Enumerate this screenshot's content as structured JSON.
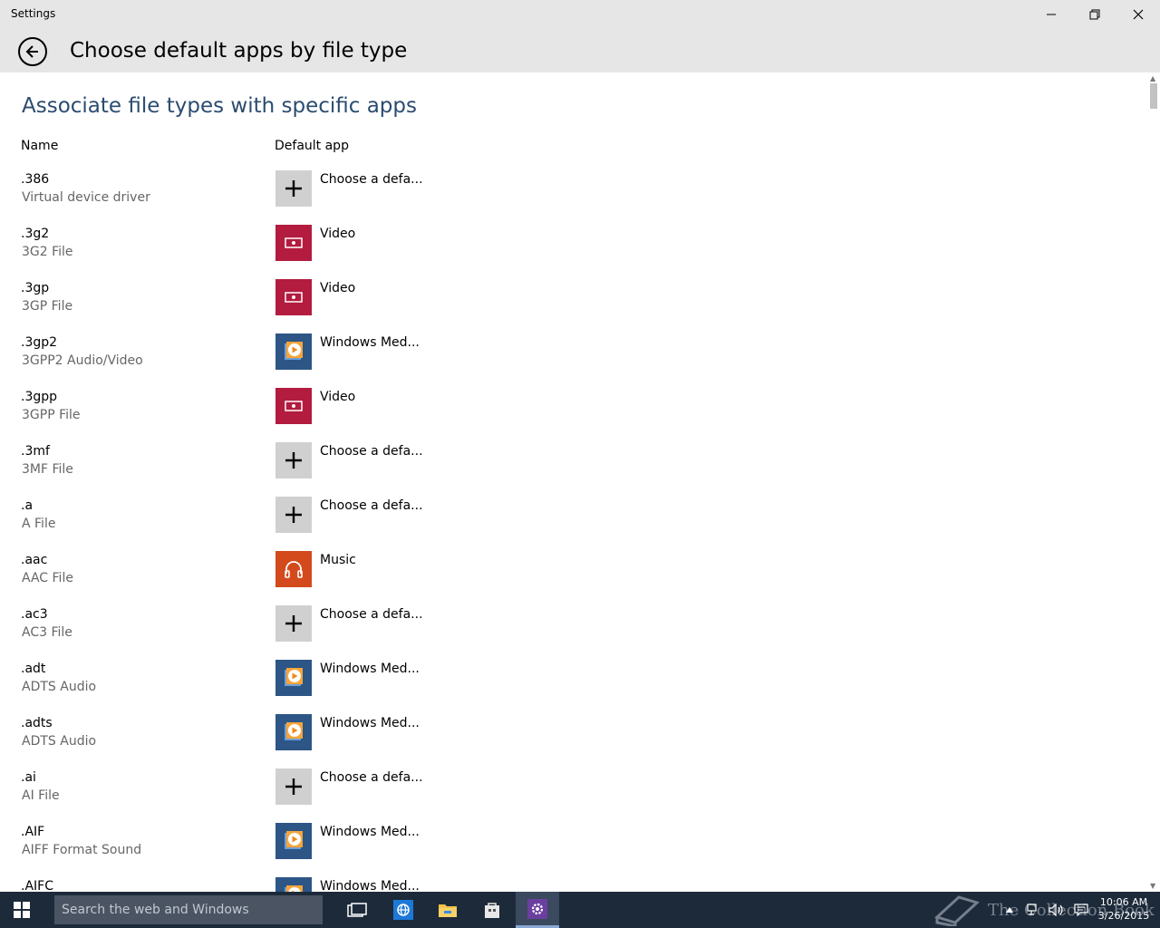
{
  "window": {
    "title": "Settings"
  },
  "header": {
    "page_title": "Choose default apps by file type"
  },
  "content": {
    "section_heading": "Associate file types with specific apps",
    "col_name": "Name",
    "col_app": "Default app",
    "rows": [
      {
        "ext": ".386",
        "desc": "Virtual device driver",
        "app": "Choose a defa...",
        "icon": "plus-icon"
      },
      {
        "ext": ".3g2",
        "desc": "3G2 File",
        "app": "Video",
        "icon": "video-app-icon"
      },
      {
        "ext": ".3gp",
        "desc": "3GP File",
        "app": "Video",
        "icon": "video-app-icon"
      },
      {
        "ext": ".3gp2",
        "desc": "3GPP2 Audio/Video",
        "app": "Windows Med...",
        "icon": "windows-media-player-icon"
      },
      {
        "ext": ".3gpp",
        "desc": "3GPP File",
        "app": "Video",
        "icon": "video-app-icon"
      },
      {
        "ext": ".3mf",
        "desc": "3MF File",
        "app": "Choose a defa...",
        "icon": "plus-icon"
      },
      {
        "ext": ".a",
        "desc": "A File",
        "app": "Choose a defa...",
        "icon": "plus-icon"
      },
      {
        "ext": ".aac",
        "desc": "AAC File",
        "app": "Music",
        "icon": "music-app-icon"
      },
      {
        "ext": ".ac3",
        "desc": "AC3 File",
        "app": "Choose a defa...",
        "icon": "plus-icon"
      },
      {
        "ext": ".adt",
        "desc": "ADTS Audio",
        "app": "Windows Med...",
        "icon": "windows-media-player-icon"
      },
      {
        "ext": ".adts",
        "desc": "ADTS Audio",
        "app": "Windows Med...",
        "icon": "windows-media-player-icon"
      },
      {
        "ext": ".ai",
        "desc": "AI File",
        "app": "Choose a defa...",
        "icon": "plus-icon"
      },
      {
        "ext": ".AIF",
        "desc": "AIFF Format Sound",
        "app": "Windows Med...",
        "icon": "windows-media-player-icon"
      },
      {
        "ext": ".AIFC",
        "desc": "",
        "app": "Windows Med...",
        "icon": "windows-media-player-icon"
      }
    ]
  },
  "taskbar": {
    "search_placeholder": "Search the web and Windows",
    "watermark": "The Collection Book",
    "time": "10:06 AM",
    "date": "3/26/2015"
  },
  "colors": {
    "titlebar_bg": "#e6e6e6",
    "heading_blue": "#2b4c6f",
    "video_tile": "#b31b3f",
    "wmp_tile": "#2d5586",
    "music_tile": "#d34a1c",
    "plus_tile": "#d0d0d0",
    "taskbar_bg": "#1d2a3a"
  }
}
